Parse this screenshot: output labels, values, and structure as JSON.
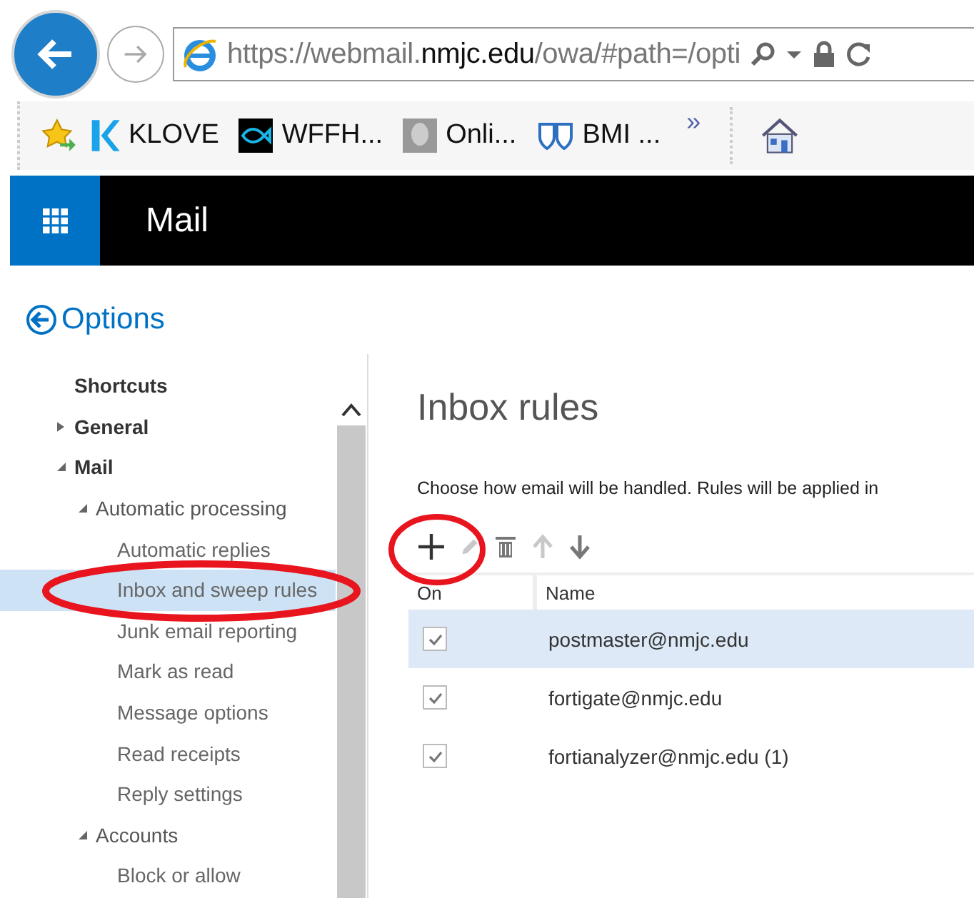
{
  "browser": {
    "url": "https://webmail.**nmjc.edu**/owa/#path=/opti",
    "favorites": [
      {
        "label": "KLOVE",
        "kind": "k"
      },
      {
        "label": "WFFH...",
        "kind": "fish"
      },
      {
        "label": "Onli...",
        "kind": "person"
      },
      {
        "label": "BMI ...",
        "kind": "shield"
      }
    ],
    "more": "»"
  },
  "app_bar": {
    "title": "Mail"
  },
  "back_link": "Options",
  "sidebar": {
    "items": [
      {
        "label": "Shortcuts",
        "kind": "heading"
      },
      {
        "label": "General",
        "expanded": false
      },
      {
        "label": "Mail",
        "expanded": true,
        "children": [
          {
            "label": "Automatic processing",
            "expanded": true,
            "children": [
              {
                "label": "Automatic replies",
                "selected": false
              },
              {
                "label": "Inbox and sweep rules",
                "selected": true
              },
              {
                "label": "Junk email reporting",
                "selected": false
              },
              {
                "label": "Mark as read",
                "selected": false
              },
              {
                "label": "Message options",
                "selected": false
              },
              {
                "label": "Read receipts",
                "selected": false
              },
              {
                "label": "Reply settings",
                "selected": false
              }
            ]
          },
          {
            "label": "Accounts",
            "expanded": true,
            "children": [
              {
                "label": "Block or allow",
                "selected": false
              }
            ]
          }
        ]
      }
    ]
  },
  "page": {
    "title": "Inbox rules",
    "description": "Choose how email will be handled. Rules will be applied in",
    "toolbar": [
      {
        "kind": "add",
        "disabled": false
      },
      {
        "kind": "edit",
        "disabled": true
      },
      {
        "kind": "delete",
        "disabled": false
      },
      {
        "kind": "up",
        "disabled": true
      },
      {
        "kind": "down",
        "disabled": false
      }
    ],
    "columns": [
      "On",
      "Name"
    ],
    "rows": [
      {
        "checked": true,
        "name": "postmaster@nmjc.edu",
        "selected": true
      },
      {
        "checked": true,
        "name": "fortigate@nmjc.edu",
        "selected": false
      },
      {
        "checked": true,
        "name": "fortianalyzer@nmjc.edu (1)",
        "selected": false
      }
    ]
  }
}
